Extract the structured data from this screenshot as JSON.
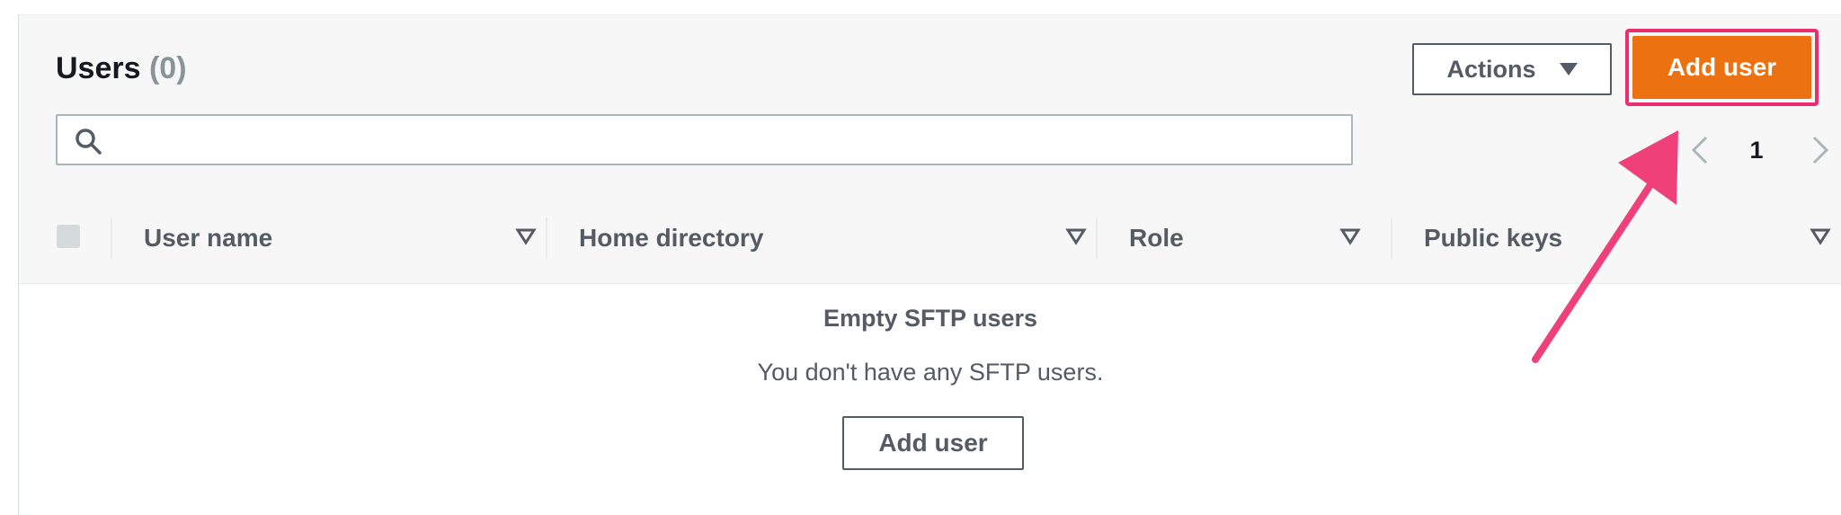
{
  "header": {
    "title": "Users",
    "count": "(0)",
    "actions_label": "Actions",
    "add_user_label": "Add user"
  },
  "search": {
    "placeholder": ""
  },
  "pagination": {
    "current_page": "1"
  },
  "table": {
    "columns": [
      "User name",
      "Home directory",
      "Role",
      "Public keys"
    ]
  },
  "empty_state": {
    "title": "Empty SFTP users",
    "description": "You don't have any SFTP users.",
    "button_label": "Add user"
  },
  "colors": {
    "primary": "#ec7211",
    "highlight": "#ee2d6e",
    "text_secondary": "#545b64"
  }
}
